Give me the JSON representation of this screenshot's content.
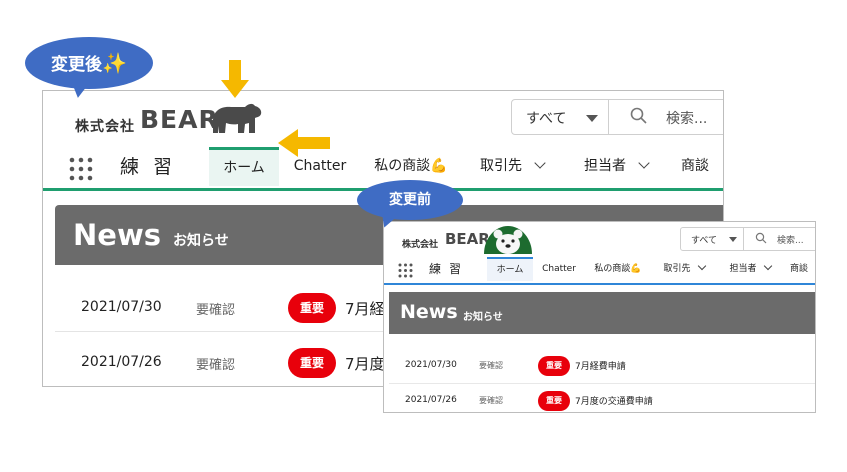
{
  "callouts": {
    "after_label": "変更後",
    "after_emoji": "✨",
    "before_label": "変更前"
  },
  "colors": {
    "callout_blue": "#3f6cc4",
    "arrow_yellow": "#f5b800",
    "after_accent": "#1f9e6f",
    "before_accent": "#2f86d8",
    "badge_red": "#e8000b",
    "panel_gray": "#6b6b6b"
  },
  "after": {
    "company": "株式会社",
    "brand": "BEAR",
    "logo_icon": "bear-silhouette-icon",
    "search": {
      "scope": "すべて",
      "placeholder": "検索..."
    },
    "app_name": "練習",
    "tabs": [
      {
        "label": "ホーム",
        "active": true,
        "has_menu": false
      },
      {
        "label": "Chatter",
        "active": false,
        "has_menu": false
      },
      {
        "label": "私の商談💪",
        "active": false,
        "has_menu": false
      },
      {
        "label": "取引先",
        "active": false,
        "has_menu": true
      },
      {
        "label": "担当者",
        "active": false,
        "has_menu": true
      },
      {
        "label": "商談",
        "active": false,
        "has_menu": false
      }
    ],
    "panel": {
      "title": "News",
      "subtitle": "お知らせ"
    },
    "news": [
      {
        "date": "2021/07/30",
        "status": "要確認",
        "badge": "重要",
        "title": "7月経"
      },
      {
        "date": "2021/07/26",
        "status": "要確認",
        "badge": "重要",
        "title": "7月度"
      }
    ]
  },
  "before": {
    "company": "株式会社",
    "brand": "BEAR",
    "logo_icon": "polar-bear-face-icon",
    "search": {
      "scope": "すべて",
      "placeholder": "検索..."
    },
    "app_name": "練習",
    "tabs": [
      {
        "label": "ホーム",
        "active": true,
        "has_menu": false
      },
      {
        "label": "Chatter",
        "active": false,
        "has_menu": false
      },
      {
        "label": "私の商談💪",
        "active": false,
        "has_menu": false
      },
      {
        "label": "取引先",
        "active": false,
        "has_menu": true
      },
      {
        "label": "担当者",
        "active": false,
        "has_menu": true
      },
      {
        "label": "商談",
        "active": false,
        "has_menu": false
      }
    ],
    "panel": {
      "title": "News",
      "subtitle": "お知らせ"
    },
    "news": [
      {
        "date": "2021/07/30",
        "status": "要確認",
        "badge": "重要",
        "title": "7月経費申請"
      },
      {
        "date": "2021/07/26",
        "status": "要確認",
        "badge": "重要",
        "title": "7月度の交通費申請"
      }
    ]
  }
}
